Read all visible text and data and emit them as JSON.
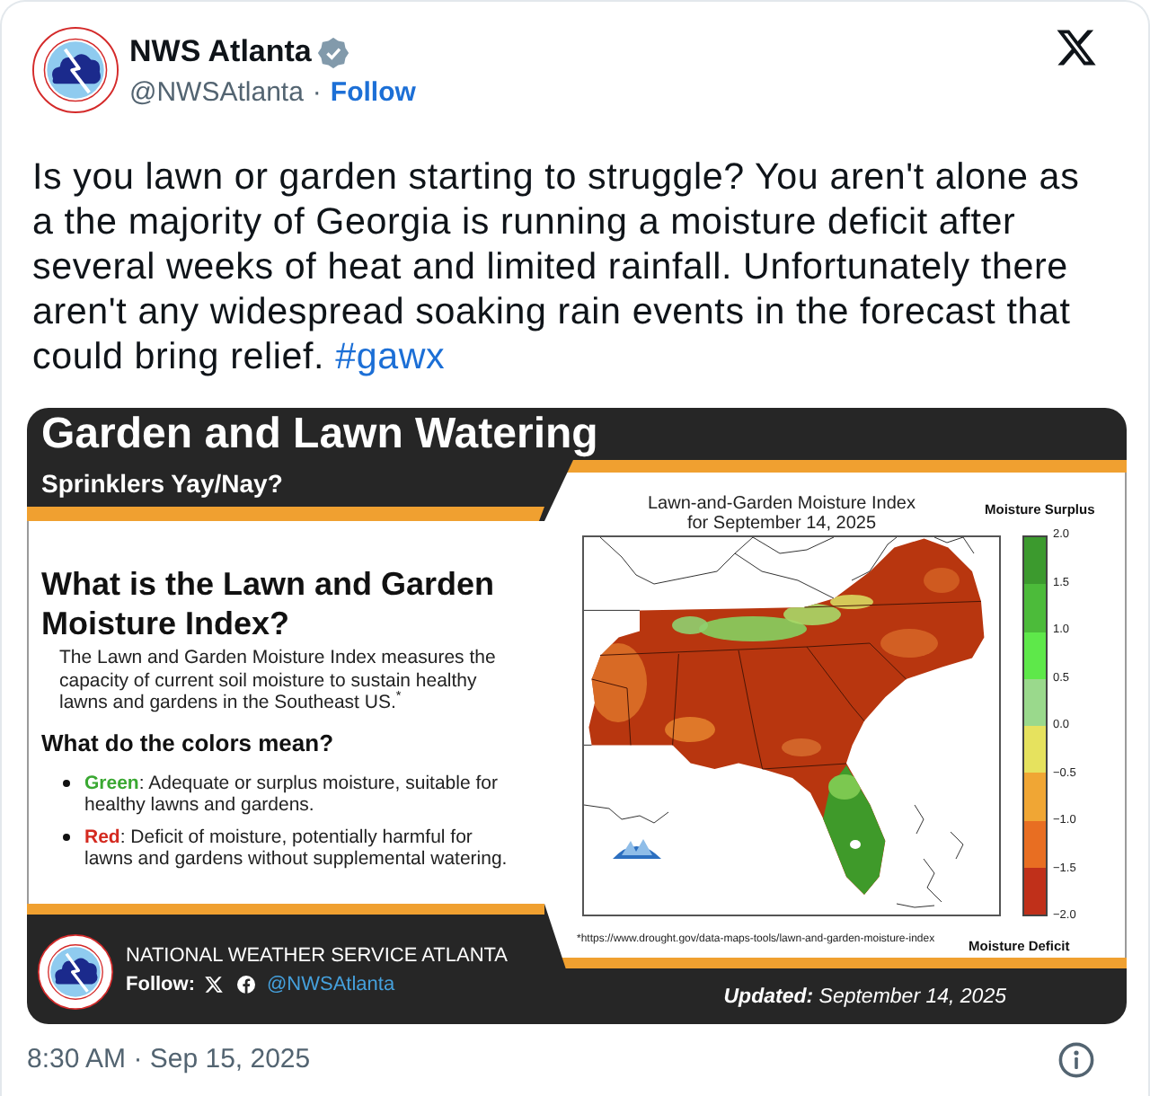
{
  "post": {
    "author": {
      "name": "NWS Atlanta",
      "verified": true,
      "handle": "@NWSAtlanta",
      "separator": "·",
      "follow": "Follow"
    },
    "text": "Is you lawn or garden starting to struggle? You aren't alone as a the majority of Georgia is running a moisture deficit after several weeks of heat and limited rainfall. Unfortunately there aren't any widespread soaking rain events in the forecast that could bring relief.",
    "hashtag": "#gawx"
  },
  "infographic": {
    "title": "Garden and Lawn Watering",
    "subtitle": "Sprinklers Yay/Nay?",
    "heading": "What is the Lawn and Garden Moisture Index?",
    "description": "The Lawn and Garden Moisture Index measures the capacity of current soil moisture to sustain healthy lawns and gardens in the Southeast US.$^{*}$",
    "colors_heading": "What do the colors mean?",
    "bullets": [
      {
        "term": "Green",
        "color": "#3aa832",
        "text": ": Adequate or surplus moisture, suitable for healthy lawns and gardens."
      },
      {
        "term": "Red",
        "color": "#d42a20",
        "text": ": Deficit of moisture, potentially harmful for lawns and gardens without supplemental watering."
      }
    ],
    "map": {
      "title": "Lawn-and-Garden Moisture Index\nfor September 14, 2025",
      "source_note": "*https://www.drought.gov/data-maps-tools/lawn-and-garden-moisture-index"
    },
    "legend": {
      "top_label": "Moisture Surplus",
      "bottom_label": "Moisture Deficit",
      "ticks": [
        "2.0",
        "1.5",
        "1.0",
        "0.5",
        "0.0",
        "−0.5",
        "−1.0",
        "−1.5",
        "−2.0"
      ],
      "bands": [
        {
          "color": "#3c9a2e"
        },
        {
          "color": "#4cbb3a"
        },
        {
          "color": "#5ee84a"
        },
        {
          "color": "#9ad98c"
        },
        {
          "color": "#e6e25e"
        },
        {
          "color": "#f0a634"
        },
        {
          "color": "#e86e22"
        },
        {
          "color": "#c0301a"
        }
      ]
    },
    "footer": {
      "org": "NATIONAL WEATHER SERVICE ATLANTA",
      "follow_label": "Follow:",
      "handle": "@NWSAtlanta",
      "updated": "**Updated:** September 14, 2025"
    }
  },
  "timestamp": "8:30 AM · Sep 15, 2025"
}
